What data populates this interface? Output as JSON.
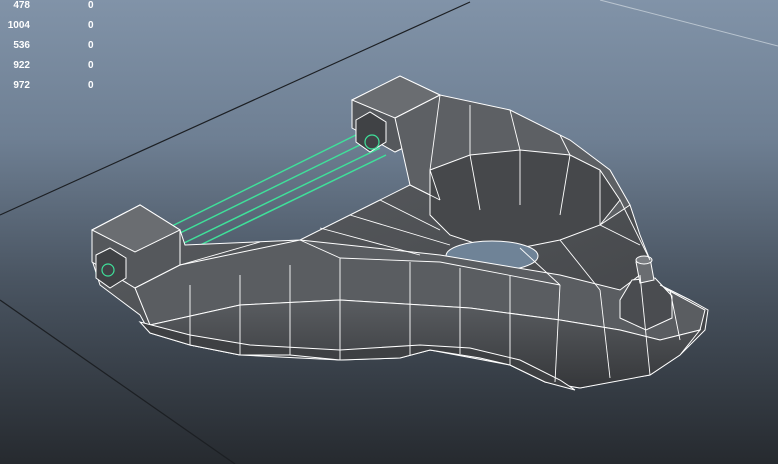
{
  "heads_up_display": {
    "rows": [
      {
        "count": "478",
        "value": "0"
      },
      {
        "count": "1004",
        "value": "0"
      },
      {
        "count": "536",
        "value": "0"
      },
      {
        "count": "922",
        "value": "0"
      },
      {
        "count": "972",
        "value": "0"
      }
    ]
  },
  "scene": {
    "background_top": "#8193a8",
    "background_bottom": "#262a2f",
    "mesh_fill": "#4f5154",
    "wireframe_color": "#ffffff",
    "selection_color": "#3fe09a"
  }
}
